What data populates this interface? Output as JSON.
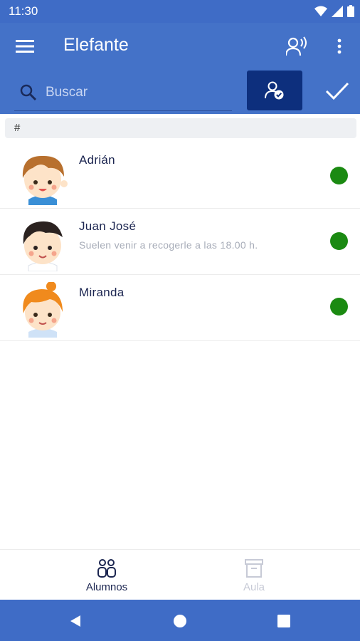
{
  "status_bar": {
    "time": "11:30",
    "icons": [
      "wifi-icon",
      "cell-signal-icon",
      "battery-icon"
    ]
  },
  "app_bar": {
    "title": "Elefante",
    "menu_icon": "hamburger-menu-icon",
    "voice_icon": "voice-person-icon",
    "more_icon": "more-vert-icon"
  },
  "search": {
    "placeholder": "Buscar",
    "value": ""
  },
  "actions": {
    "attendance_icon": "person-check-icon",
    "confirm_icon": "checkmark-icon"
  },
  "section": {
    "header": "#"
  },
  "students": [
    {
      "name": "Adrián",
      "note": "",
      "status_color": "#1b8a12",
      "avatar": "boy-brown-hair-avatar"
    },
    {
      "name": "Juan José",
      "note": "Suelen venir a recogerle a las 18.00 h.",
      "status_color": "#1b8a12",
      "avatar": "boy-dark-hair-avatar"
    },
    {
      "name": "Miranda",
      "note": "",
      "status_color": "#1b8a12",
      "avatar": "girl-orange-hair-avatar"
    }
  ],
  "bottom_nav": {
    "items": [
      {
        "label": "Alumnos",
        "icon": "students-icon",
        "active": true
      },
      {
        "label": "Aula",
        "icon": "archive-box-icon",
        "active": false
      }
    ]
  },
  "system_nav": {
    "buttons": [
      "back-icon",
      "home-icon",
      "recents-icon"
    ]
  },
  "colors": {
    "primary": "#4472c8",
    "primary_dark": "#3f6cc6",
    "accent_button": "#0d2f7d",
    "status_present": "#1b8a12"
  }
}
